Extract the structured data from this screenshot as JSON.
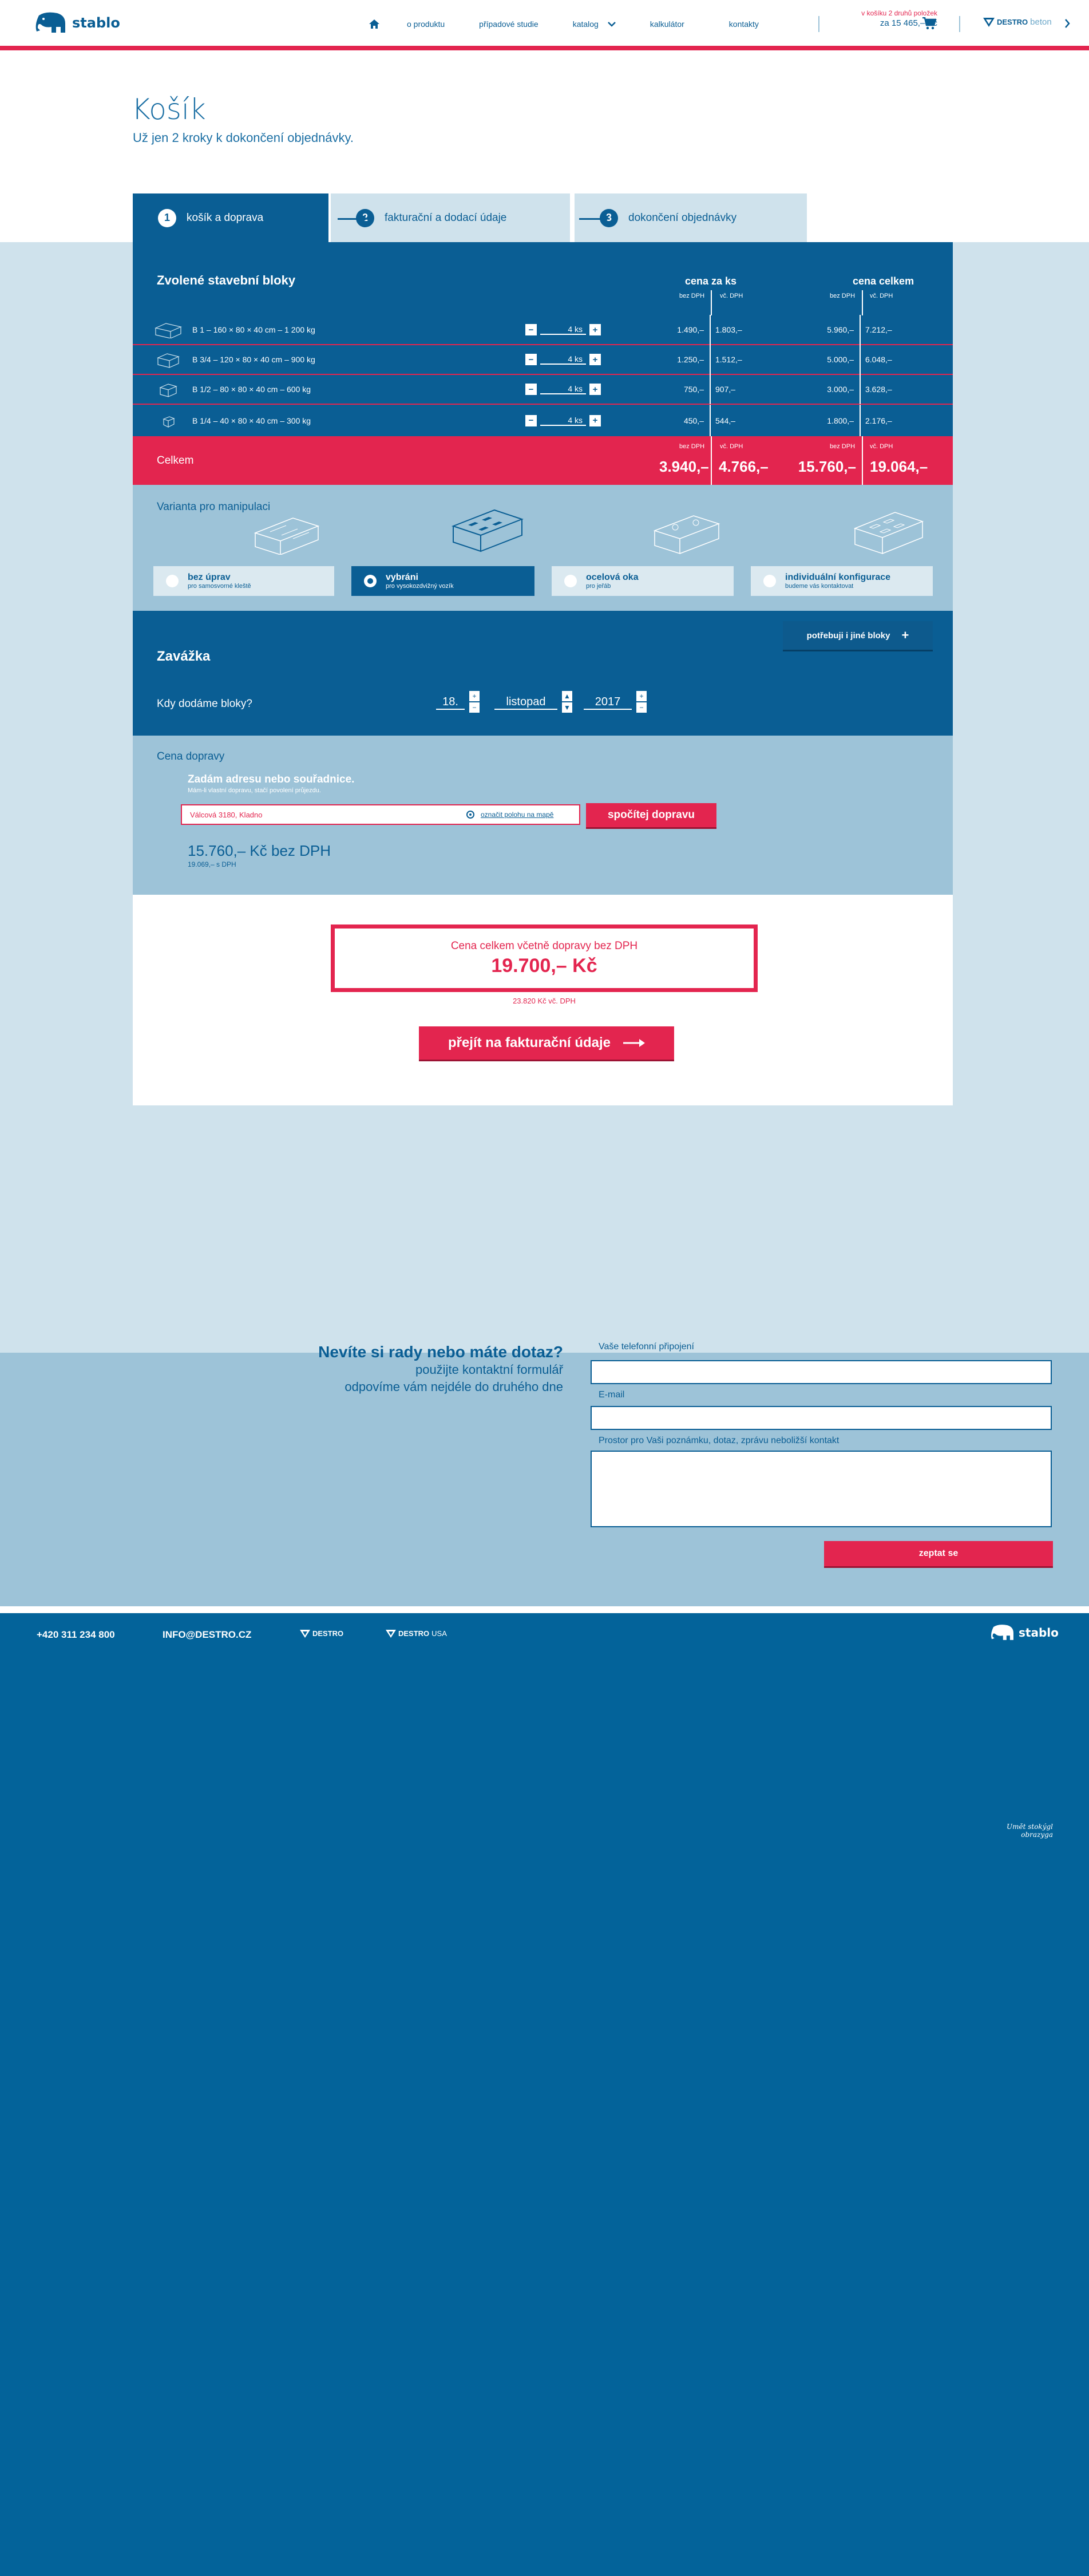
{
  "header": {
    "brand": "stablo",
    "nav": [
      "o produktu",
      "případové studie",
      "katalog",
      "kalkulátor",
      "kontakty"
    ],
    "cart_note": "v košíku 2 druhů položek",
    "cart_total": "za 15 465,– Kč",
    "partner_bold": "DESTRO",
    "partner_light": "beton"
  },
  "page": {
    "title": "Košík",
    "subtitle": "Už jen 2 kroky k dokončení objednávky."
  },
  "steps": [
    {
      "num": "1",
      "label": "košík a doprava"
    },
    {
      "num": "2",
      "label": "fakturační a dodací údaje"
    },
    {
      "num": "3",
      "label": "dokončení objednávky"
    }
  ],
  "blocks": {
    "heading": "Zvolené stavební bloky",
    "col_price": "cena za ks",
    "col_total": "cena celkem",
    "bez_dph": "bez DPH",
    "vc_dph": "vč. DPH",
    "rows": [
      {
        "name": "B 1 – 160 × 80 × 40 cm – 1 200 kg",
        "qty": "4 ks",
        "p_bez": "1.490,–",
        "p_vc": "1.803,–",
        "t_bez": "5.960,–",
        "t_vc": "7.212,–"
      },
      {
        "name": "B 3/4 – 120 × 80 × 40 cm – 900 kg",
        "qty": "4 ks",
        "p_bez": "1.250,–",
        "p_vc": "1.512,–",
        "t_bez": "5.000,–",
        "t_vc": "6.048,–"
      },
      {
        "name": "B 1/2 – 80 × 80 × 40 cm – 600 kg",
        "qty": "4 ks",
        "p_bez": "750,–",
        "p_vc": "907,–",
        "t_bez": "3.000,–",
        "t_vc": "3.628,–"
      },
      {
        "name": "B 1/4 – 40 × 80 × 40 cm – 300 kg",
        "qty": "4 ks",
        "p_bez": "450,–",
        "p_vc": "544,–",
        "t_bez": "1.800,–",
        "t_vc": "2.176,–"
      }
    ],
    "total_label": "Celkem",
    "total_p_bez": "3.940,–",
    "total_p_vc": "4.766,–",
    "total_t_bez": "15.760,–",
    "total_t_vc": "19.064,–"
  },
  "variant": {
    "heading": "Varianta pro manipulaci",
    "options": [
      {
        "title": "bez úprav",
        "sub": "pro samosvorné kleště"
      },
      {
        "title": "vybráni",
        "sub": "pro vysokozdvižný vozík"
      },
      {
        "title": "ocelová oka",
        "sub": "pro jeřáb"
      },
      {
        "title": "individuální konfigurace",
        "sub": "budeme vás kontaktovat"
      }
    ]
  },
  "other_blocks_button": "potřebuji i jiné bloky",
  "delivery": {
    "heading": "Zavážka",
    "question": "Kdy dodáme bloky?",
    "day": "18.",
    "month": "listopad",
    "year": "2017"
  },
  "transport": {
    "heading": "Cena dopravy",
    "lead": "Zadám adresu nebo souřadnice.",
    "lead_sub": "Mám-li vlastní dopravu, stačí povolení průjezdu.",
    "address": "Válcová 3180, Kladno",
    "map_link": "označit polohu na mapě",
    "calc_button": "spočítej dopravu",
    "price": "15.760,– Kč bez DPH",
    "price_vat": "19.069,– s DPH"
  },
  "summary": {
    "label": "Cena celkem včetně dopravy bez DPH",
    "amount": "19.700,– Kč",
    "vat": "23.820 Kč vč. DPH",
    "next_button": "přejít na fakturační údaje"
  },
  "contact": {
    "heading": "Nevíte si rady nebo máte dotaz?",
    "line1": "použijte kontaktní formulář",
    "line2": "odpovíme vám nejdéle do druhého dne",
    "phone_label": "Vaše telefonní připojení",
    "email_label": "E-mail",
    "message_label": "Prostor pro Vaši poznámku, dotaz, zprávu neboližší kontakt",
    "submit": "zeptat se"
  },
  "footer": {
    "phone": "+420 311 234 800",
    "email": "INFO@DESTRO.CZ",
    "destro1": "DESTRO",
    "destro2_bold": "DESTRO",
    "destro2_light": "USA",
    "brand": "stablo",
    "signature": "Umět stokýgl obrazyga"
  }
}
